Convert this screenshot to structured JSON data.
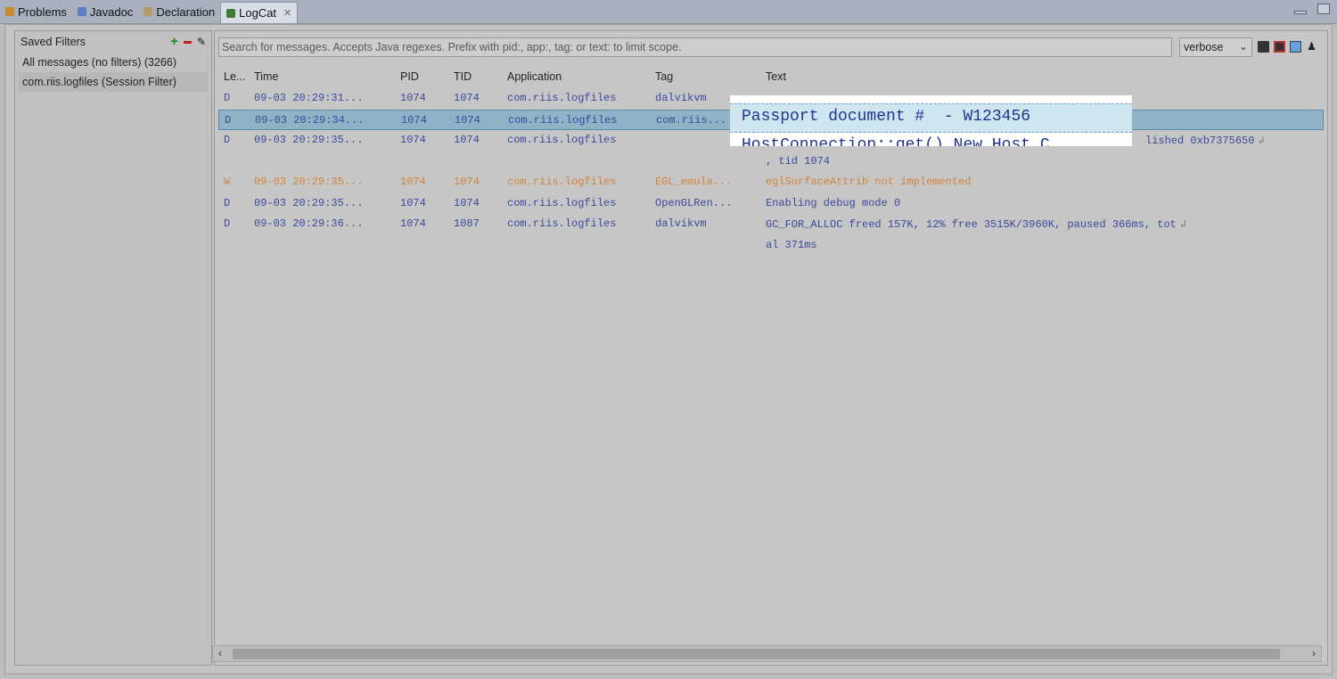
{
  "tabs": [
    {
      "label": "Problems",
      "active": false,
      "icon": "problems-icon",
      "color": "#c98a2b"
    },
    {
      "label": "Javadoc",
      "active": false,
      "icon": "javadoc-icon",
      "color": "#5a7fc0"
    },
    {
      "label": "Declaration",
      "active": false,
      "icon": "declaration-icon",
      "color": "#b49a6a"
    },
    {
      "label": "LogCat",
      "active": true,
      "icon": "logcat-icon",
      "color": "#3a7a3a"
    }
  ],
  "filters": {
    "title": "Saved Filters",
    "items": [
      {
        "label": "All messages (no filters) (3266)",
        "selected": false
      },
      {
        "label": "com.riis.logfiles (Session Filter)",
        "selected": true
      }
    ]
  },
  "search": {
    "placeholder": "Search for messages. Accepts Java regexes. Prefix with pid:, app:, tag: or text: to limit scope.",
    "value": ""
  },
  "level_select": {
    "value": "verbose"
  },
  "table": {
    "headers": [
      "Le...",
      "Time",
      "PID",
      "TID",
      "Application",
      "Tag",
      "Text"
    ],
    "rows": [
      {
        "level": "D",
        "time": "09-03 20:29:31...",
        "pid": "1074",
        "tid": "1074",
        "app": "com.riis.logfiles",
        "tag": "dalvikvm",
        "text": "",
        "selected": false,
        "warn": false
      },
      {
        "level": "D",
        "time": "09-03 20:29:34...",
        "pid": "1074",
        "tid": "1074",
        "app": "com.riis.logfiles",
        "tag": "com.riis...",
        "text": "",
        "selected": true,
        "warn": false
      },
      {
        "level": "D",
        "time": "09-03 20:29:35...",
        "pid": "1074",
        "tid": "1074",
        "app": "com.riis.logfiles",
        "tag": "",
        "text": "lished 0xb7375650",
        "selected": false,
        "warn": false,
        "wrap": true
      },
      {
        "level": "",
        "time": "",
        "pid": "",
        "tid": "",
        "app": "",
        "tag": "",
        "text": ", tid 1074",
        "selected": false,
        "warn": false
      },
      {
        "level": "W",
        "time": "09-03 20:29:35...",
        "pid": "1074",
        "tid": "1074",
        "app": "com.riis.logfiles",
        "tag": "EGL_emula...",
        "text": "eglSurfaceAttrib not implemented",
        "selected": false,
        "warn": true
      },
      {
        "level": "D",
        "time": "09-03 20:29:35...",
        "pid": "1074",
        "tid": "1074",
        "app": "com.riis.logfiles",
        "tag": "OpenGLRen...",
        "text": "Enabling debug mode 0",
        "selected": false,
        "warn": false
      },
      {
        "level": "D",
        "time": "09-03 20:29:36...",
        "pid": "1074",
        "tid": "1087",
        "app": "com.riis.logfiles",
        "tag": "dalvikvm",
        "text": "GC_FOR_ALLOC freed 157K, 12% free 3515K/3960K, paused 366ms, tot",
        "selected": false,
        "warn": false,
        "wrap": true
      },
      {
        "level": "",
        "time": "",
        "pid": "",
        "tid": "",
        "app": "",
        "tag": "",
        "text": "al 371ms",
        "selected": false,
        "warn": false
      }
    ]
  },
  "popup": {
    "text": "Passport document #  - W123456",
    "under_text": "HostConnection::get() New Host C"
  },
  "colors": {
    "debug_text": "#3a4a9a",
    "warn_text": "#d4833a",
    "selected_row": "#8fb2c6",
    "popup_text": "#1f3593"
  }
}
